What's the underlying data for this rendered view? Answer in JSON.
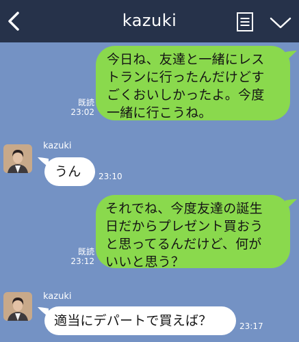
{
  "header": {
    "title": "kazuki"
  },
  "messages": [
    {
      "type": "sent",
      "text": "今日ね、友達と一緒にレス\nトランに行ったんだけどす\nごくおいしかったよ。今度\n一緒に行こうね。",
      "read": "既読",
      "time": "23:02"
    },
    {
      "type": "received",
      "sender": "kazuki",
      "text": "うん",
      "time": "23:10"
    },
    {
      "type": "sent",
      "text": "それでね、今度友達の誕生\n日だからプレゼント買おう\nと思ってるんだけど、何が\nいいと思う？",
      "read": "既読",
      "time": "23:12"
    },
    {
      "type": "received",
      "sender": "kazuki",
      "text": "適当にデパートで買えば？",
      "time": "23:17"
    }
  ]
}
